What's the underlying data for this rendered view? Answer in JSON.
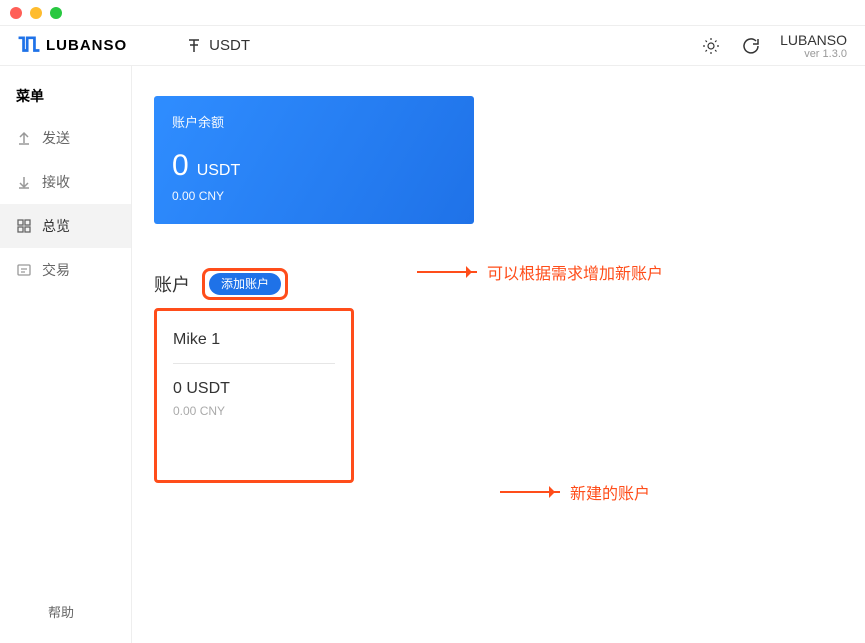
{
  "brand": {
    "name": "LUBANSO",
    "name_right": "LUBANSO",
    "version": "ver 1.3.0"
  },
  "header": {
    "currency": "USDT"
  },
  "sidebar": {
    "title": "菜单",
    "items": [
      {
        "label": "发送"
      },
      {
        "label": "接收"
      },
      {
        "label": "总览"
      },
      {
        "label": "交易"
      }
    ],
    "help": "帮助"
  },
  "balance": {
    "label": "账户余额",
    "amount": "0",
    "unit": "USDT",
    "sub": "0.00 CNY"
  },
  "accounts": {
    "title": "账户",
    "add_label": "添加账户",
    "list": [
      {
        "name": "Mike 1",
        "amount": "0 USDT",
        "sub": "0.00 CNY"
      }
    ]
  },
  "annotations": {
    "add_hint": "可以根据需求增加新账户",
    "new_account_hint": "新建的账户"
  }
}
